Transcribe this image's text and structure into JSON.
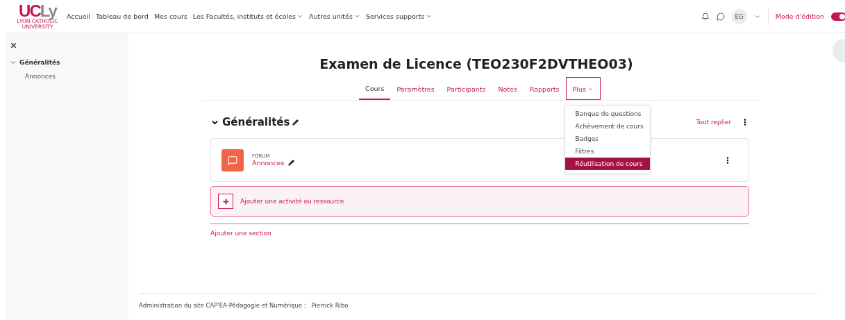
{
  "logo": {
    "mark_first": "UC",
    "mark_second": "Ly",
    "tagline": "LYON CATHOLIC UNIVERSITY"
  },
  "nav": [
    {
      "label": "Accueil",
      "has_menu": false
    },
    {
      "label": "Tableau de bord",
      "has_menu": false
    },
    {
      "label": "Mes cours",
      "has_menu": false
    },
    {
      "label": "Les Facultés, instituts et écoles",
      "has_menu": true
    },
    {
      "label": "Autres unités",
      "has_menu": true
    },
    {
      "label": "Services supports",
      "has_menu": true
    }
  ],
  "user": {
    "initials": "EG"
  },
  "edit_mode": {
    "label": "Mode d'édition",
    "on": true
  },
  "sidebar": {
    "items": [
      {
        "label": "Généralités",
        "expanded": true,
        "children": [
          {
            "label": "Annonces"
          }
        ]
      }
    ]
  },
  "course": {
    "title": "Examen de Licence (TEO230F2DVTHEO03)"
  },
  "tabs": [
    {
      "label": "Cours",
      "selected": true,
      "has_menu": false,
      "highlighted": false
    },
    {
      "label": "Paramètres",
      "selected": false,
      "has_menu": false,
      "highlighted": false
    },
    {
      "label": "Participants",
      "selected": false,
      "has_menu": false,
      "highlighted": false
    },
    {
      "label": "Notes",
      "selected": false,
      "has_menu": false,
      "highlighted": false
    },
    {
      "label": "Rapports",
      "selected": false,
      "has_menu": false,
      "highlighted": false
    },
    {
      "label": "Plus",
      "selected": false,
      "has_menu": true,
      "highlighted": true
    }
  ],
  "more_menu": [
    {
      "label": "Banque de questions",
      "selected": false
    },
    {
      "label": "Achèvement de cours",
      "selected": false
    },
    {
      "label": "Badges",
      "selected": false
    },
    {
      "label": "Filtres",
      "selected": false
    },
    {
      "label": "Réutilisation de cours",
      "selected": true
    }
  ],
  "section": {
    "title": "Généralités",
    "expanded": true,
    "collapse_all": "Tout replier",
    "activities": [
      {
        "type": "FORUM",
        "name": "Annonces"
      }
    ],
    "add_activity": "Ajouter une activité ou ressource"
  },
  "add_section": "Ajouter une section",
  "footer": {
    "label": "Administration du site CAP'EA-Pédagogie et Numérique :",
    "name": "Pierrick Ribo"
  }
}
